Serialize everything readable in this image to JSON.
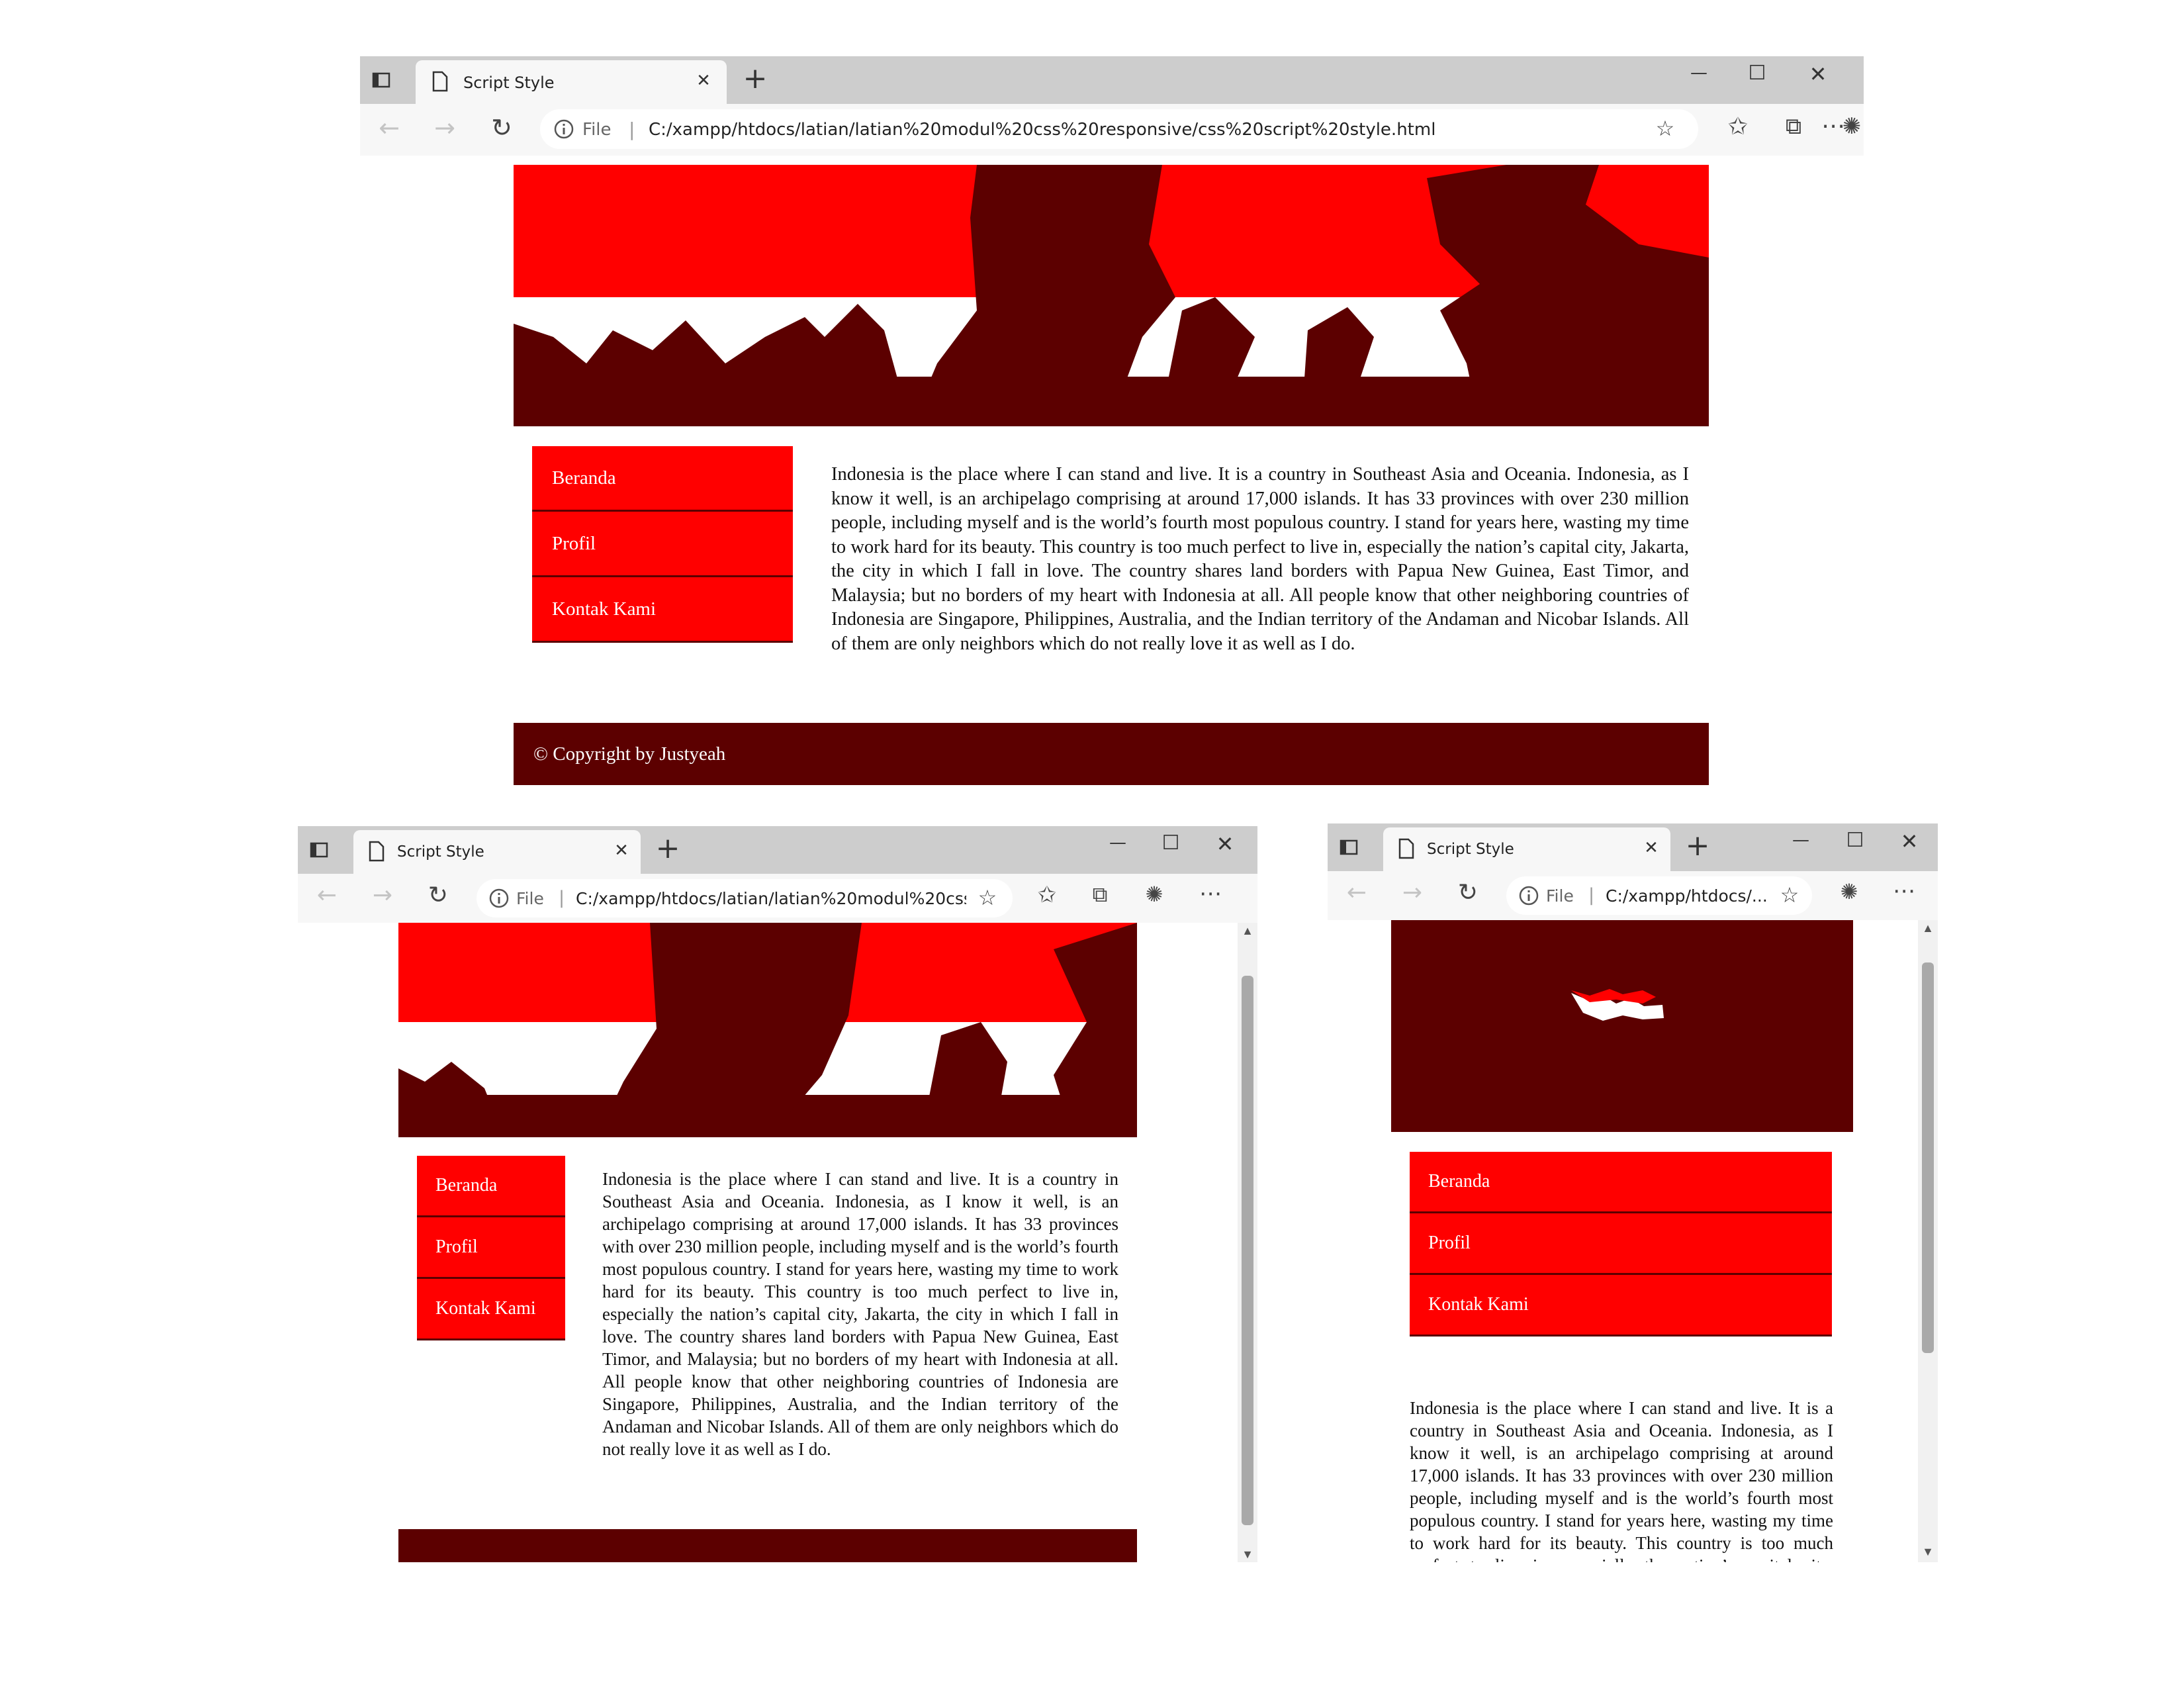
{
  "tab": {
    "title": "Script Style",
    "close": "✕",
    "new": "+"
  },
  "window_controls": {
    "minimize": "—",
    "maximize": "☐",
    "close": "✕"
  },
  "address": {
    "label": "File",
    "url_full": "C:/xampp/htdocs/latian/latian%20modul%20css%20responsive/css%20script%20style.html",
    "url_medium": "C:/xampp/htdocs/latian/latian%20modul%20css%...",
    "url_short": "C:/xampp/htdocs/..."
  },
  "menu": {
    "items": [
      "Beranda",
      "Profil",
      "Kontak Kami"
    ]
  },
  "content": {
    "text": "Indonesia is the place where I can stand and live. It is a country in Southeast Asia and Oceania. Indonesia, as I know it well, is an archipelago comprising at around 17,000 islands. It has 33 provinces with over 230 million people, including myself and is the world’s fourth most populous country. I stand for years here, wasting my time to work hard for its beauty. This country is too much perfect to live in, especially the nation’s capital city, Jakarta, the city in which I fall in love. The country shares land borders with Papua New Guinea, East Timor, and Malaysia; but no borders of my heart with Indonesia at all. All people know that other neighboring countries of Indonesia are Singapore, Philippines, Australia, and the Indian territory of the Andaman and Nicobar Islands. All of them are only neighbors which do not really love it as well as I do."
  },
  "footer": {
    "text": "© Copyright by Justyeah"
  },
  "colors": {
    "menu_red": "#ff0000",
    "dark_red": "#5c0000",
    "banner_white": "#ffffff",
    "tab_strip": "#cdcdcd"
  },
  "icons": [
    "sidebar-icon",
    "page-icon",
    "back-icon",
    "forward-icon",
    "refresh-icon",
    "info-icon",
    "add-favorite-icon",
    "favorites-icon",
    "collections-icon",
    "profile-icon",
    "more-icon"
  ]
}
